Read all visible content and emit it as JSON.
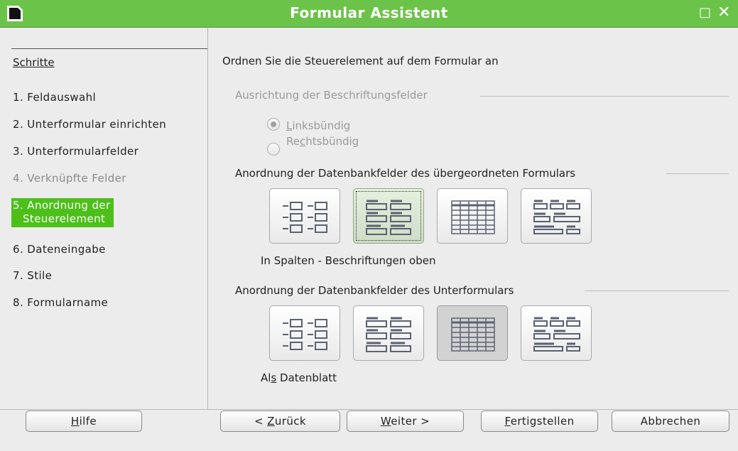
{
  "window": {
    "title": "Formular Assistent",
    "maximize_glyph": "□",
    "close_glyph": "✕"
  },
  "sidebar": {
    "heading": "Schritte",
    "steps": [
      {
        "label": "1. Feldauswahl",
        "state": "normal"
      },
      {
        "label": "2. Unterformular einrichten",
        "state": "normal"
      },
      {
        "label": "3. Unterformularfelder",
        "state": "normal"
      },
      {
        "label": "4. Verknüpfte Felder",
        "state": "disabled"
      },
      {
        "label": "5. Anordnung der",
        "label2": "Steuerelement",
        "state": "active"
      },
      {
        "label": "6. Dateneingabe",
        "state": "normal"
      },
      {
        "label": "7. Stile",
        "state": "normal"
      },
      {
        "label": "8. Formularname",
        "state": "normal"
      }
    ]
  },
  "main": {
    "instruction": "Ordnen Sie die Steuerelement auf dem Formular an",
    "label_alignment": {
      "title": "Ausrichtung der Beschriftungsfelder",
      "options": [
        {
          "pre": "",
          "mnemonic": "L",
          "post": "inksbündig",
          "checked": true
        },
        {
          "pre": "Re",
          "mnemonic": "c",
          "post": "htsbündig",
          "checked": false
        }
      ]
    },
    "master_arrangement": {
      "title": "Anordnung der Datenbankfelder des übergeordneten Formulars",
      "selected_index": 1,
      "selected_caption": "In Spalten - Beschriftungen oben"
    },
    "sub_arrangement": {
      "title": "Anordnung der Datenbankfelder des Unterformulars",
      "selected_index": 2,
      "caption_pre": "Al",
      "caption_mnemonic": "s",
      "caption_post": " Datenblatt"
    },
    "layout_options": [
      "columns-labels-left",
      "columns-labels-top",
      "as-data-sheet",
      "in-blocks-labels-above"
    ]
  },
  "buttons": {
    "help": {
      "mnemonic": "H",
      "rest": "ilfe"
    },
    "back": {
      "pre": "< ",
      "mnemonic": "Z",
      "rest": "urück"
    },
    "next": {
      "mnemonic": "W",
      "rest": "eiter >"
    },
    "finish": {
      "mnemonic": "F",
      "rest": "ertigstellen"
    },
    "cancel": {
      "label": "Abbrechen"
    }
  },
  "colors": {
    "titlebar": "#6cc34a",
    "active_step": "#4cbf1a"
  }
}
